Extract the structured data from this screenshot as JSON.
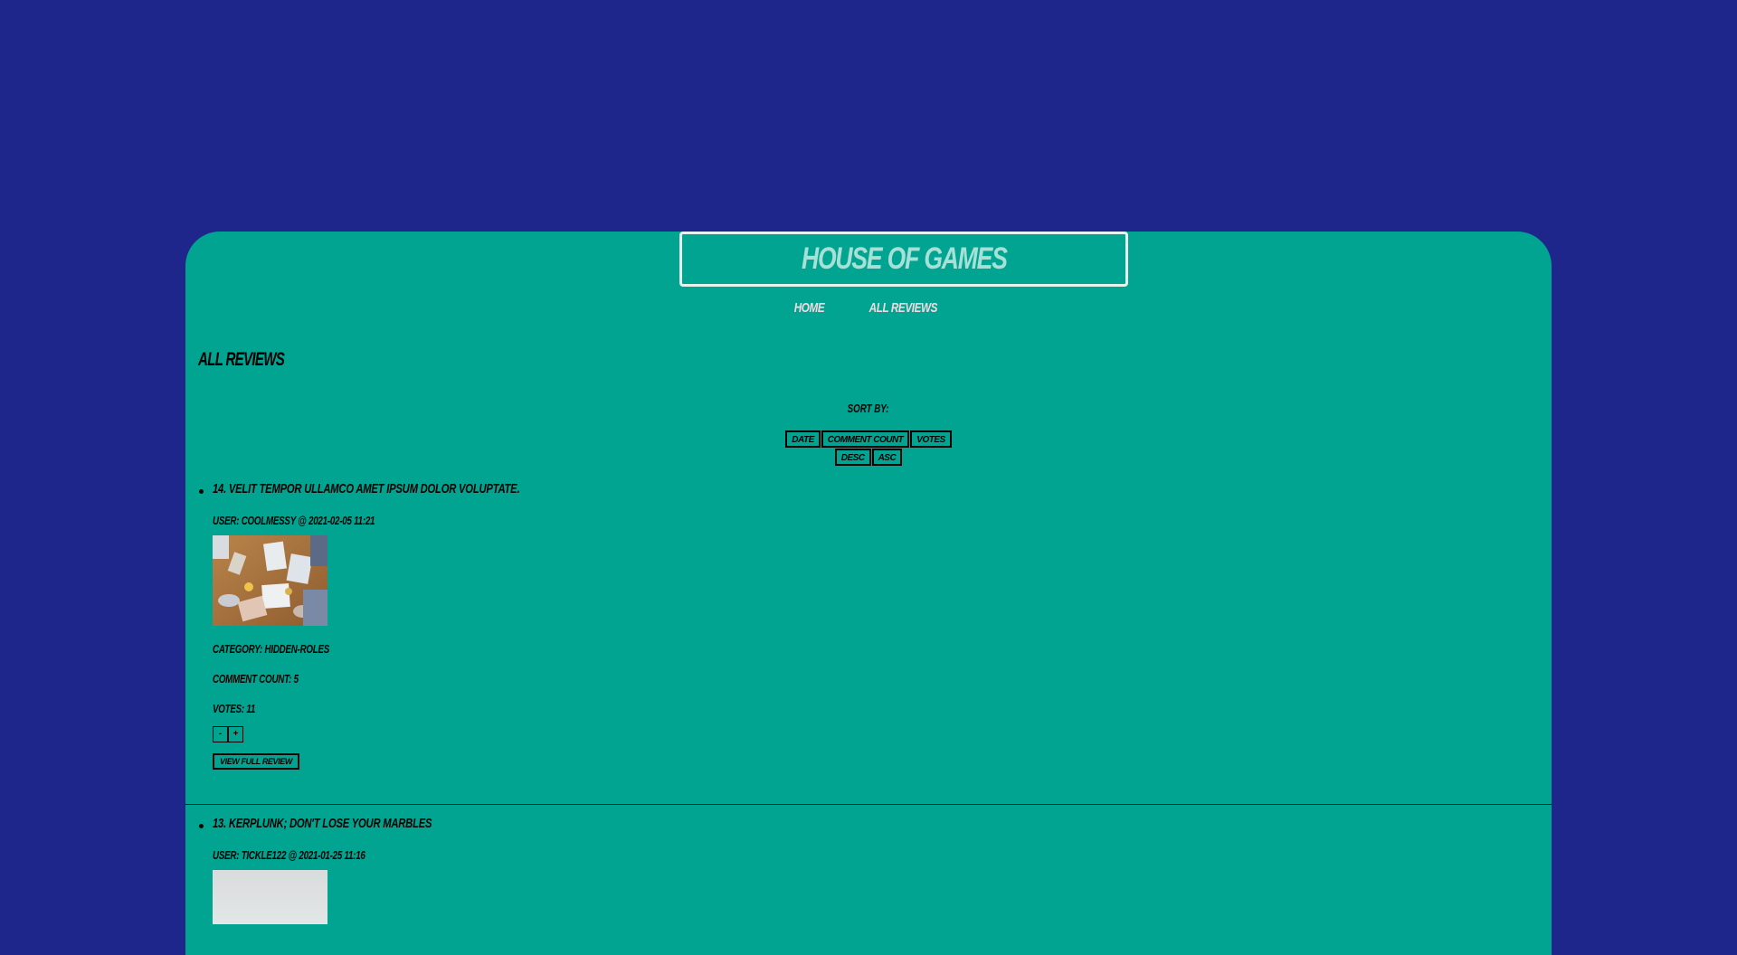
{
  "header": {
    "title": "House of Games",
    "nav": [
      {
        "label": "Home"
      },
      {
        "label": "All Reviews"
      }
    ]
  },
  "page": {
    "heading": "All Reviews",
    "sort": {
      "label": "Sort by:",
      "fields": [
        "Date",
        "Comment Count",
        "Votes"
      ],
      "orders": [
        "Desc",
        "Asc"
      ]
    }
  },
  "reviews": [
    {
      "title": "14. Velit tempor ullamco amet ipsum dolor voluptate.",
      "user_line": "User: coolmessy @ 2021-02-05 11:21",
      "category_line": "Category: hidden-roles",
      "comment_count_line": "Comment Count: 5",
      "votes_line": "Votes: 11",
      "downvote": "-",
      "upvote": "+",
      "view_label": "View Full Review"
    },
    {
      "title": "13. Kerplunk; Don't lose your marbles",
      "user_line": "User: tickle122 @ 2021-01-25 11:16"
    }
  ]
}
